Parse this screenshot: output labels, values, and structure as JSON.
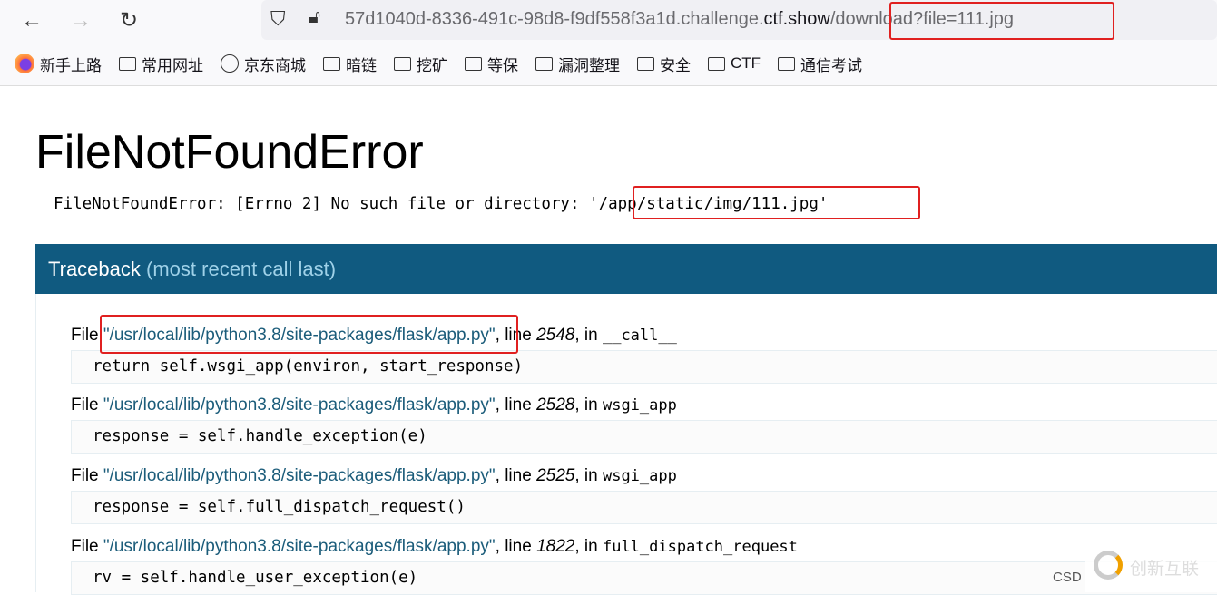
{
  "browser": {
    "url_host_prefix": "57d1040d-8336-491c-98d8-f9df558f3a1d.challenge.",
    "url_host": "ctf.show",
    "url_path": "/download?file=111.jpg",
    "bookmarks": [
      {
        "label": "新手上路",
        "icon": "firefox-icon"
      },
      {
        "label": "常用网址",
        "icon": "folder-icon"
      },
      {
        "label": "京东商城",
        "icon": "globe-icon"
      },
      {
        "label": "暗链",
        "icon": "folder-icon"
      },
      {
        "label": "挖矿",
        "icon": "folder-icon"
      },
      {
        "label": "等保",
        "icon": "folder-icon"
      },
      {
        "label": "漏洞整理",
        "icon": "folder-icon"
      },
      {
        "label": "安全",
        "icon": "folder-icon"
      },
      {
        "label": "CTF",
        "icon": "folder-icon"
      },
      {
        "label": "通信考试",
        "icon": "folder-icon"
      }
    ]
  },
  "error": {
    "title": "FileNotFoundError",
    "message": "FileNotFoundError: [Errno 2] No such file or directory: '/app/static/img/111.jpg'"
  },
  "traceback": {
    "title": "Traceback",
    "subtitle": "(most recent call last)",
    "frames": [
      {
        "file": "\"/usr/local/lib/python3.8/site-packages/flask/app.py\"",
        "line": "2548",
        "func": "__call__",
        "code": "return self.wsgi_app(environ, start_response)"
      },
      {
        "file": "\"/usr/local/lib/python3.8/site-packages/flask/app.py\"",
        "line": "2528",
        "func": "wsgi_app",
        "code": "response = self.handle_exception(e)"
      },
      {
        "file": "\"/usr/local/lib/python3.8/site-packages/flask/app.py\"",
        "line": "2525",
        "func": "wsgi_app",
        "code": "response = self.full_dispatch_request()"
      },
      {
        "file": "\"/usr/local/lib/python3.8/site-packages/flask/app.py\"",
        "line": "1822",
        "func": "full_dispatch_request",
        "code": "rv = self.handle_user_exception(e)"
      }
    ]
  },
  "labels": {
    "file": "File ",
    "line": ", line ",
    "in": ", in "
  },
  "watermark": {
    "text": "创新互联",
    "csd": "CSD"
  },
  "colors": {
    "traceback_header": "#105a80",
    "annotation": "#e02020"
  }
}
